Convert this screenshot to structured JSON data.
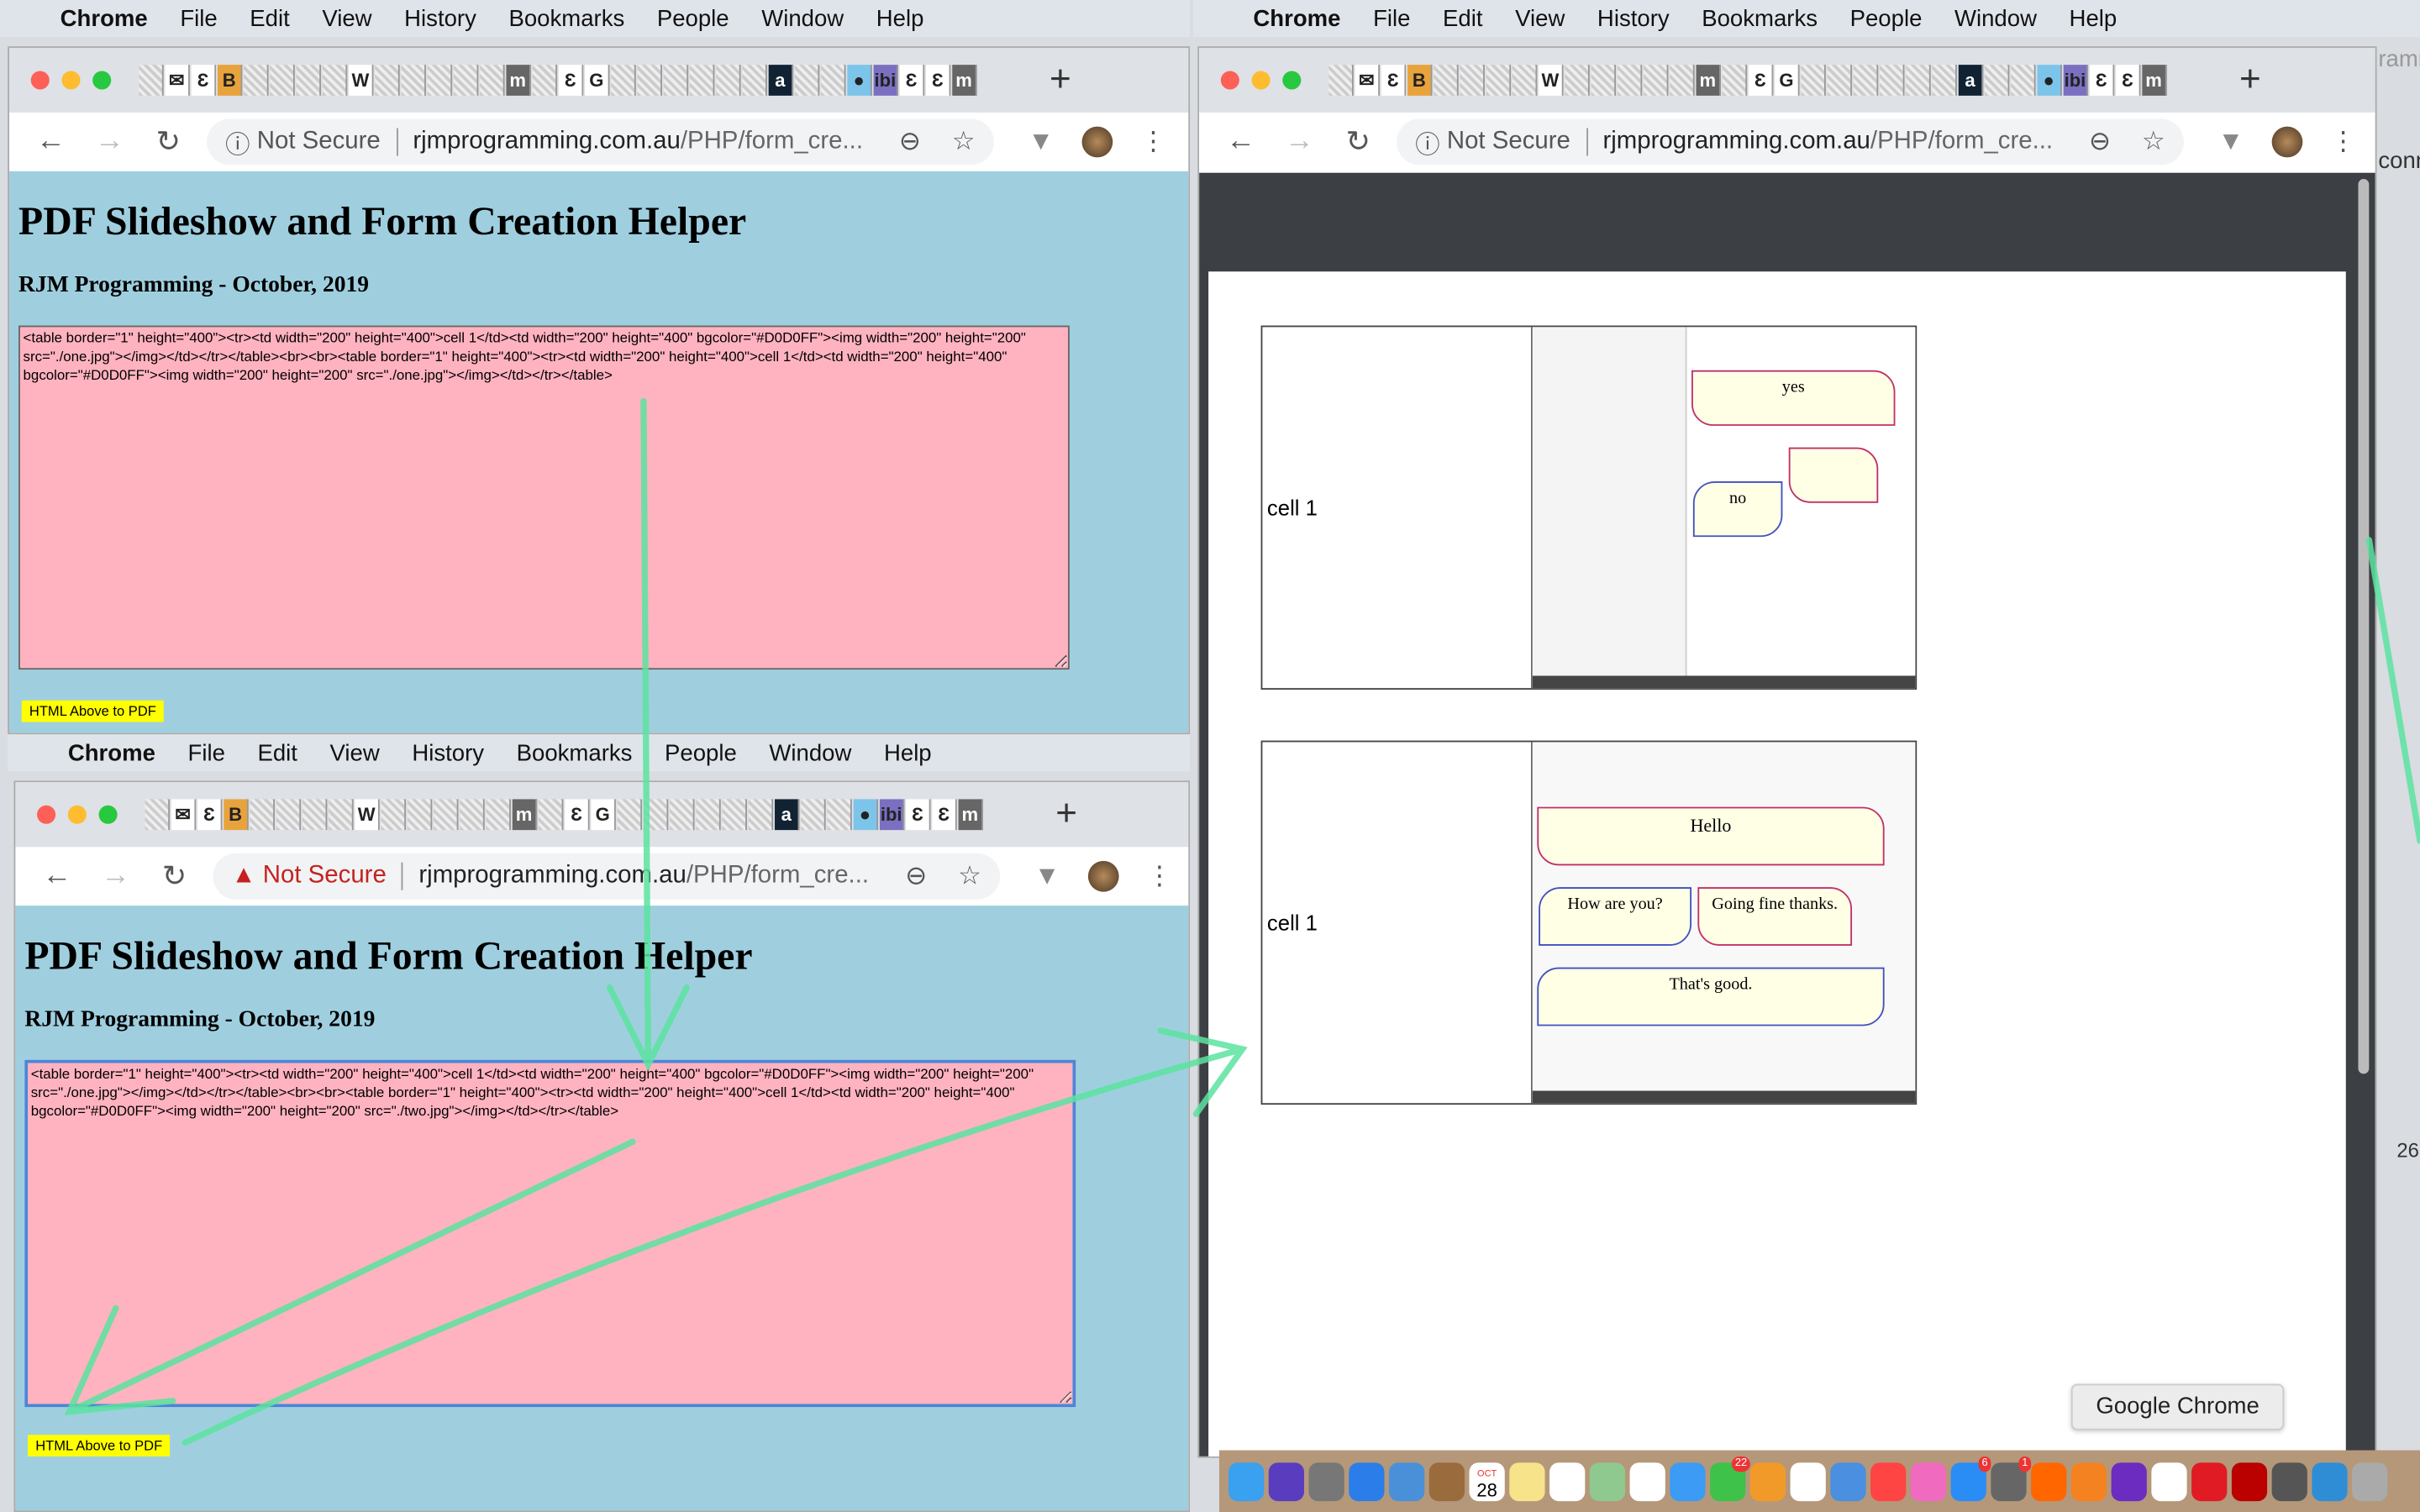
{
  "menubar": {
    "app": "Chrome",
    "items": [
      "File",
      "Edit",
      "View",
      "History",
      "Bookmarks",
      "People",
      "Window",
      "Help"
    ]
  },
  "browser": {
    "not_secure": "Not Secure",
    "url_host": "rjmprogramming.com.au",
    "url_path": "/PHP/form_cre...",
    "new_tab": "+",
    "favicons": [
      "blank",
      "gmail",
      "wp",
      "blogger",
      "blank",
      "blank",
      "blank",
      "blank",
      "W",
      "blank",
      "blank",
      "blank",
      "blank",
      "blank",
      "museum",
      "blank",
      "wp",
      "G",
      "blank",
      "blank",
      "blank",
      "blank",
      "blank",
      "blank",
      "a",
      "blank",
      "blank",
      "mapper",
      "ibi",
      "wp",
      "wp",
      "museum"
    ],
    "traffic_lights": {
      "close": "#fe5f57",
      "minimize": "#febc2e",
      "zoom": "#28c840"
    }
  },
  "page": {
    "title": "PDF Slideshow and Form Creation Helper",
    "subtitle": "RJM Programming - October, 2019",
    "button": "HTML Above to PDF",
    "bg": "#9fcfdf",
    "textarea_bg": "#ffb3c0",
    "textarea_top": "<table border=\"1\" height=\"400\"><tr><td width=\"200\" height=\"400\">cell 1</td><td width=\"200\" height=\"400\" bgcolor=\"#D0D0FF\"><img width=\"200\" height=\"200\" src=\"./one.jpg\"></img></td></tr></table><br><br><table border=\"1\" height=\"400\"><tr><td width=\"200\" height=\"400\">cell 1</td><td width=\"200\" height=\"400\" bgcolor=\"#D0D0FF\"><img width=\"200\" height=\"200\" src=\"./one.jpg\"></img></td></tr></table>",
    "textarea_bottom": "<table border=\"1\" height=\"400\"><tr><td width=\"200\" height=\"400\">cell 1</td><td width=\"200\" height=\"400\" bgcolor=\"#D0D0FF\"><img width=\"200\" height=\"200\" src=\"./one.jpg\"></img></td></tr></table><br><br><table border=\"1\" height=\"400\"><tr><td width=\"200\" height=\"400\">cell 1</td><td width=\"200\" height=\"400\" bgcolor=\"#D0D0FF\"><img width=\"200\" height=\"200\" src=\"./two.jpg\"></img></td></tr></table>"
  },
  "pdf": {
    "tables": [
      {
        "cell": "cell 1",
        "bubbles": [
          "yes",
          "no",
          ""
        ]
      },
      {
        "cell": "cell 1",
        "bubbles": [
          "Hello",
          "How are you?",
          "Going fine thanks.",
          "That's good."
        ]
      }
    ]
  },
  "dock": {
    "tooltip": "Google Chrome",
    "calendar_month": "OCT",
    "calendar_day": "28",
    "badges": {
      "facetime": "22",
      "appstore": "6",
      "preferences": "1"
    },
    "icons": [
      "finder",
      "siri",
      "launchpad",
      "safari",
      "mail",
      "contacts",
      "calendar",
      "notes",
      "reminders",
      "maps",
      "photos",
      "messages",
      "facetime",
      "pages",
      "numbers",
      "keynote",
      "news",
      "itunes",
      "appstore",
      "preferences",
      "avast",
      "firefox",
      "phpstorm",
      "chrome",
      "opera",
      "filezilla",
      "sequel-pro",
      "cyberduck",
      "script-editor"
    ]
  },
  "side_peek": {
    "text_1": "ramm",
    "text_2": "conn",
    "text_3": "26"
  },
  "annotation_color": "#5be3a0"
}
